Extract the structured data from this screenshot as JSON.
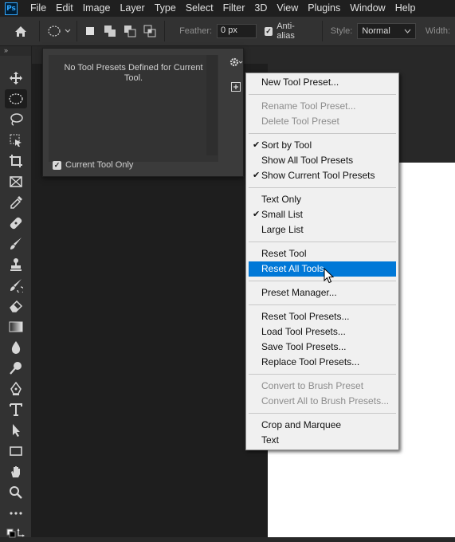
{
  "app": {
    "logo": "Ps"
  },
  "menubar": [
    "File",
    "Edit",
    "Image",
    "Layer",
    "Type",
    "Select",
    "Filter",
    "3D",
    "View",
    "Plugins",
    "Window",
    "Help"
  ],
  "options": {
    "feather_label": "Feather:",
    "feather_value": "0 px",
    "antialias_label": "Anti-alias",
    "style_label": "Style:",
    "style_value": "Normal",
    "width_label": "Width:"
  },
  "toolbar": {
    "collapse_glyph": "»"
  },
  "preset_panel": {
    "empty_message": "No Tool Presets Defined for Current Tool.",
    "current_tool_only_label": "Current Tool Only"
  },
  "flyout": {
    "groups": [
      [
        {
          "label": "New Tool Preset...",
          "disabled": false,
          "checked": false
        }
      ],
      [
        {
          "label": "Rename Tool Preset...",
          "disabled": true,
          "checked": false
        },
        {
          "label": "Delete Tool Preset",
          "disabled": true,
          "checked": false
        }
      ],
      [
        {
          "label": "Sort by Tool",
          "disabled": false,
          "checked": true
        },
        {
          "label": "Show All Tool Presets",
          "disabled": false,
          "checked": false
        },
        {
          "label": "Show Current Tool Presets",
          "disabled": false,
          "checked": true
        }
      ],
      [
        {
          "label": "Text Only",
          "disabled": false,
          "checked": false
        },
        {
          "label": "Small List",
          "disabled": false,
          "checked": true
        },
        {
          "label": "Large List",
          "disabled": false,
          "checked": false
        }
      ],
      [
        {
          "label": "Reset Tool",
          "disabled": false,
          "checked": false
        },
        {
          "label": "Reset All Tools",
          "disabled": false,
          "checked": false,
          "highlighted": true
        }
      ],
      [
        {
          "label": "Preset Manager...",
          "disabled": false,
          "checked": false
        }
      ],
      [
        {
          "label": "Reset Tool Presets...",
          "disabled": false,
          "checked": false
        },
        {
          "label": "Load Tool Presets...",
          "disabled": false,
          "checked": false
        },
        {
          "label": "Save Tool Presets...",
          "disabled": false,
          "checked": false
        },
        {
          "label": "Replace Tool Presets...",
          "disabled": false,
          "checked": false
        }
      ],
      [
        {
          "label": "Convert to Brush Preset",
          "disabled": true,
          "checked": false
        },
        {
          "label": "Convert All to Brush Presets...",
          "disabled": true,
          "checked": false
        }
      ],
      [
        {
          "label": "Crop and Marquee",
          "disabled": false,
          "checked": false
        },
        {
          "label": "Text",
          "disabled": false,
          "checked": false
        }
      ]
    ]
  },
  "colors": {
    "accent": "#0078d7",
    "ps_blue": "#31a8ff"
  }
}
